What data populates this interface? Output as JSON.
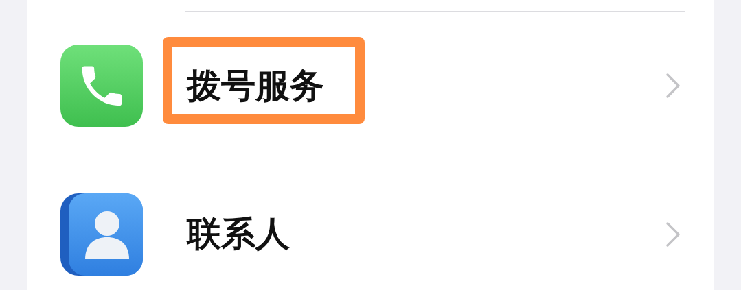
{
  "rows": [
    {
      "kind": "phone",
      "label": "拨号服务",
      "highlighted": true
    },
    {
      "kind": "contacts",
      "label": "联系人",
      "highlighted": false
    }
  ]
}
